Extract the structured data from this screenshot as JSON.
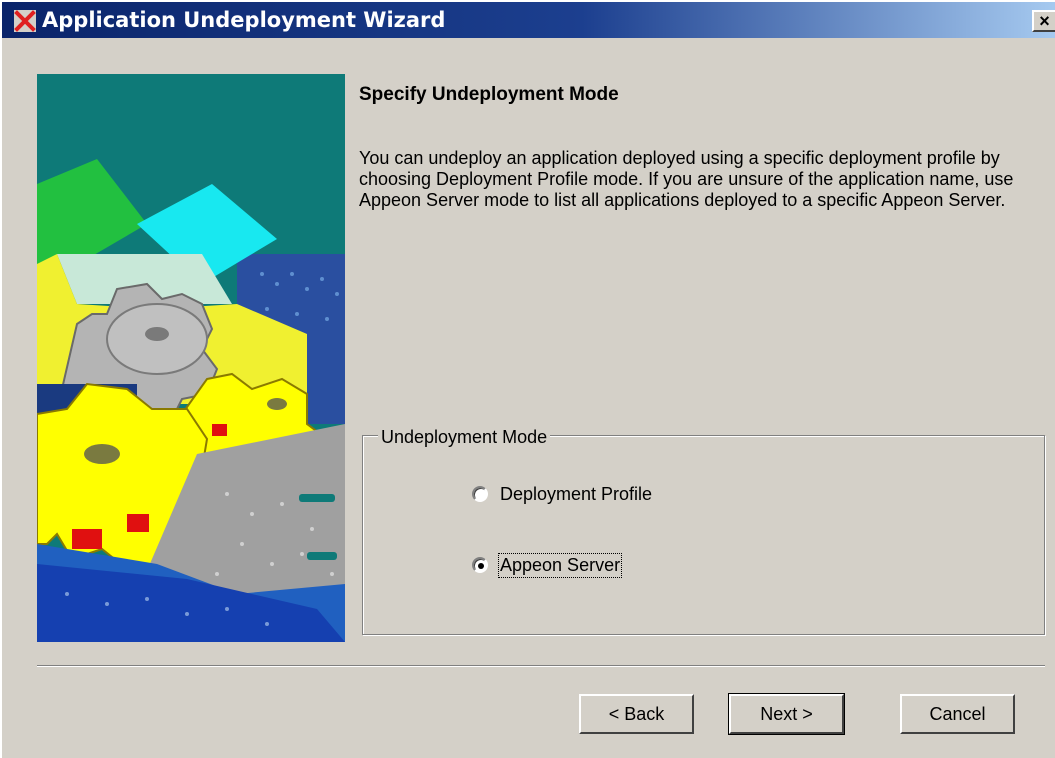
{
  "window": {
    "title": "Application Undeployment Wizard",
    "close_glyph": "×"
  },
  "page": {
    "heading": "Specify Undeployment Mode",
    "description": "You can undeploy an application deployed using a specific deployment profile by choosing Deployment Profile mode. If you are unsure of the application name, use Appeon Server mode to list all applications deployed to a specific Appeon Server."
  },
  "mode_group": {
    "label": "Undeployment Mode",
    "options": [
      {
        "label": "Deployment Profile",
        "selected": false
      },
      {
        "label": "Appeon Server",
        "selected": true
      }
    ]
  },
  "buttons": {
    "back": "< Back",
    "next": "Next >",
    "cancel": "Cancel"
  },
  "icons": {
    "app": "app-x-icon",
    "close": "close-icon"
  },
  "colors": {
    "titlebar_start": "#0a246a",
    "titlebar_end": "#a6caf0",
    "dialog_face": "#d4d0c8",
    "image_teal": "#0e7a78",
    "gear_yellow": "#ffff00"
  }
}
